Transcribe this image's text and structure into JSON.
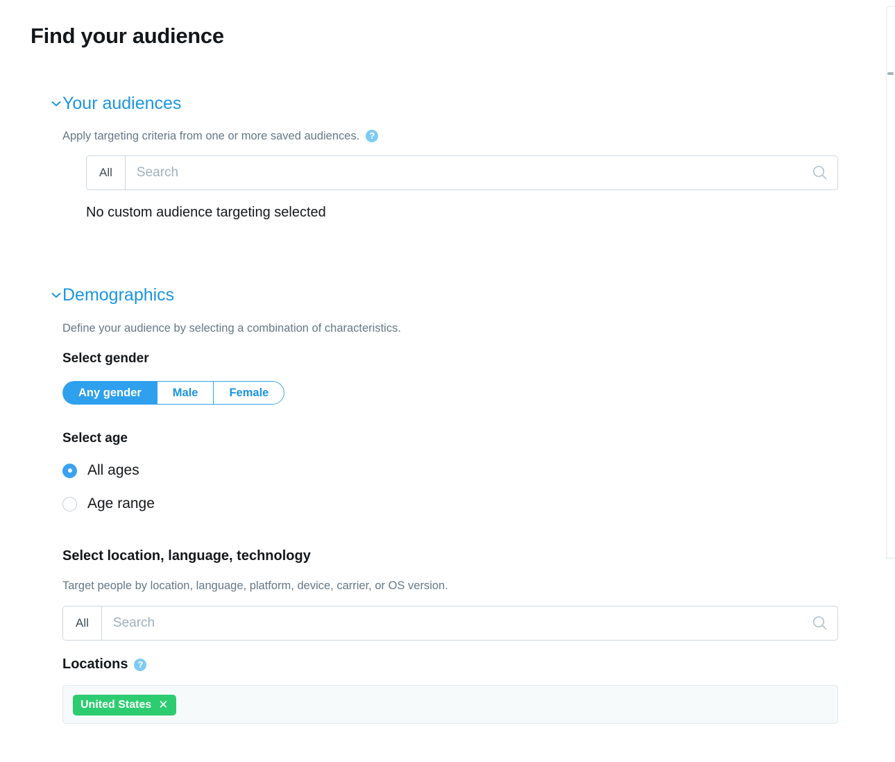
{
  "page": {
    "title": "Find your audience"
  },
  "sections": {
    "your_audiences": {
      "header": "Your audiences",
      "chevron_icon": "chevron-down-icon",
      "subtitle": "Apply targeting criteria from one or more saved audiences.",
      "help_icon_label": "?",
      "search": {
        "scope_label": "All",
        "placeholder": "Search",
        "value": "",
        "search_icon": "search-icon"
      },
      "empty_state": "No custom audience targeting selected"
    },
    "demographics": {
      "header": "Demographics",
      "chevron_icon": "chevron-down-icon",
      "subtitle": "Define your audience by selecting a combination of characteristics.",
      "gender": {
        "label": "Select gender",
        "options": [
          {
            "label": "Any gender",
            "selected": true
          },
          {
            "label": "Male",
            "selected": false
          },
          {
            "label": "Female",
            "selected": false
          }
        ]
      },
      "age": {
        "label": "Select age",
        "options": [
          {
            "label": "All ages",
            "selected": true
          },
          {
            "label": "Age range",
            "selected": false
          }
        ]
      },
      "location_tech": {
        "label": "Select location, language, technology",
        "subtitle": "Target people by location, language, platform, device, carrier, or OS version.",
        "search": {
          "scope_label": "All",
          "placeholder": "Search",
          "value": "",
          "search_icon": "search-icon"
        },
        "locations": {
          "label": "Locations",
          "help_icon_label": "?",
          "tokens": [
            {
              "label": "United States",
              "remove_icon": "close-icon",
              "remove_glyph": "✕"
            }
          ]
        }
      }
    }
  },
  "colors": {
    "accent_blue": "#1b95e0",
    "toggle_blue": "#2fa0ee",
    "radio_blue": "#3ba2f0",
    "help_blue": "#7ecbf3",
    "token_green": "#2ecc71",
    "text_dark": "#14171a",
    "text_muted": "#657786",
    "border": "#ccd6dd"
  }
}
